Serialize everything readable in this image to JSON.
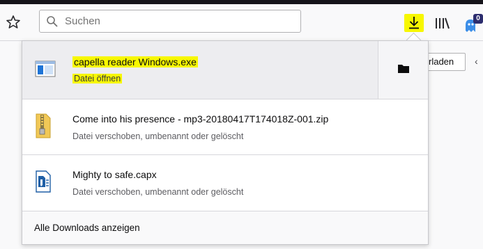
{
  "toolbar": {
    "search_placeholder": "Suchen",
    "extension_badge": "0",
    "page_button_label": "rladen",
    "page_arrow": "‹"
  },
  "downloads": {
    "items": [
      {
        "name": "capella reader Windows.exe",
        "status": "Datei öffnen",
        "icon": "exe-icon",
        "selected": true
      },
      {
        "name": "Come into his presence - mp3-20180417T174018Z-001.zip",
        "status": "Datei verschoben, umbenannt oder gelöscht",
        "icon": "zip-icon"
      },
      {
        "name": "Mighty to safe.capx",
        "status": "Datei verschoben, umbenannt oder gelöscht",
        "icon": "capx-icon"
      }
    ],
    "footer_label": "Alle Downloads anzeigen"
  },
  "colors": {
    "highlight": "#f7f700",
    "badge": "#2c2d6e"
  }
}
